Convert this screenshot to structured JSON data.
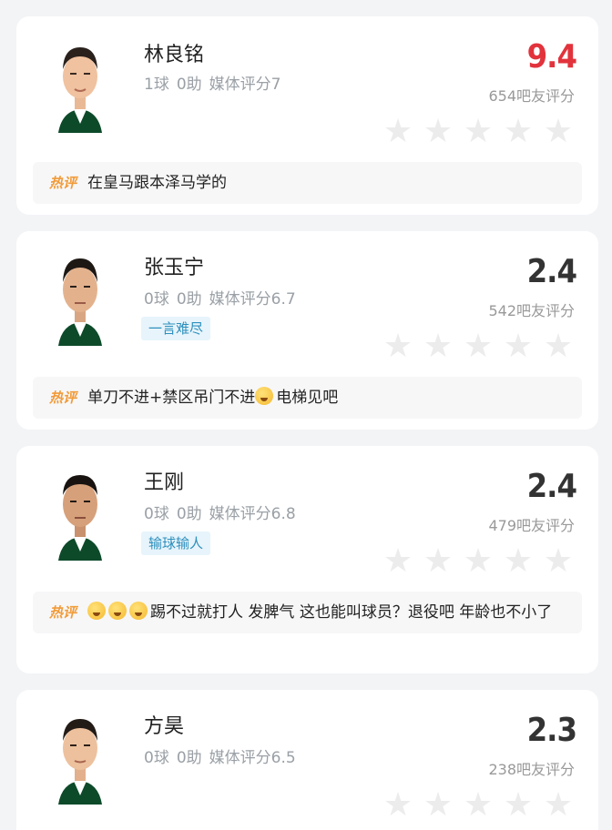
{
  "players": [
    {
      "name": "林良铭",
      "goals": "1球",
      "assists": "0助",
      "media_rating": "媒体评分7",
      "tag": "",
      "score": "9.4",
      "fan_count": "654吧友评分",
      "hot_label": "热评",
      "comment_emojis": 0,
      "comment": "在皇马跟本泽马学的"
    },
    {
      "name": "张玉宁",
      "goals": "0球",
      "assists": "0助",
      "media_rating": "媒体评分6.7",
      "tag": "一言难尽",
      "score": "2.4",
      "fan_count": "542吧友评分",
      "hot_label": "热评",
      "comment": "单刀不进+禁区吊门不进",
      "comment_tail": "电梯见吧"
    },
    {
      "name": "王刚",
      "goals": "0球",
      "assists": "0助",
      "media_rating": "媒体评分6.8",
      "tag": "输球输人",
      "score": "2.4",
      "fan_count": "479吧友评分",
      "hot_label": "热评",
      "comment_emojis": 3,
      "comment": "踢不过就打人 发脾气 这也能叫球员？退役吧 年龄也不小了"
    },
    {
      "name": "方昊",
      "goals": "0球",
      "assists": "0助",
      "media_rating": "媒体评分6.5",
      "tag": "",
      "score": "2.3",
      "fan_count": "238吧友评分"
    }
  ],
  "colors": {
    "hot_score": "#e2333c",
    "score": "#333333",
    "hot_badge": "#f29b38",
    "tag_text": "#2c8fbd",
    "tag_bg": "#e7f4fb",
    "star_empty": "#ececec"
  },
  "icons": {
    "star": "star-icon",
    "emoji": "crying-face-emoji-icon"
  }
}
